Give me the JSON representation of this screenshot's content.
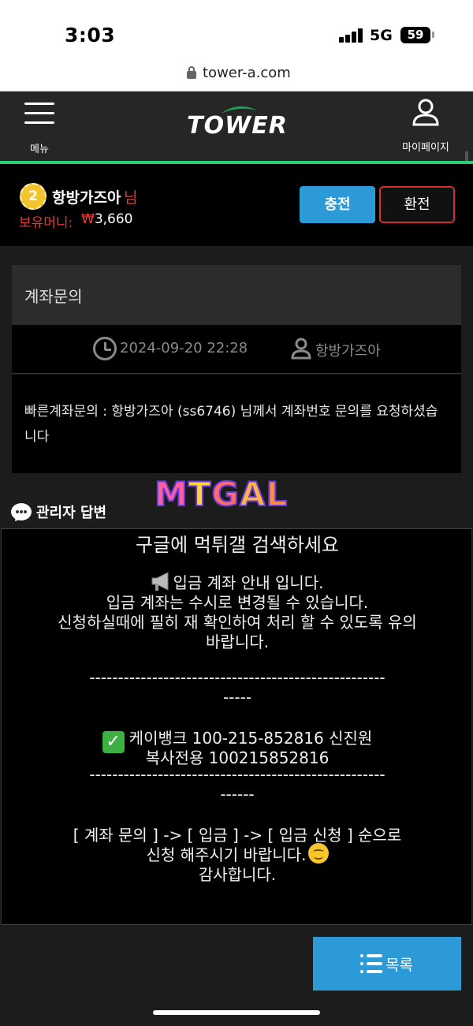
{
  "status_bar": {
    "time": "3:03",
    "network": "5G",
    "battery": "59"
  },
  "browser": {
    "url": "tower-a.com"
  },
  "header": {
    "menu_label": "메뉴",
    "logo_text": "TOWER",
    "mypage_label": "마이페이지"
  },
  "user": {
    "level": "2",
    "name": "항방가즈아",
    "suffix": "님",
    "money_label": "보유머니:",
    "money_currency": "₩",
    "money_value": "3,660",
    "charge_label": "충전",
    "exchange_label": "환전"
  },
  "post": {
    "title": "계좌문의",
    "date": "2024-09-20 22:28",
    "author": "항방가즈아",
    "body": "빠른계좌문의 : 항방가즈아 (ss6746) 님께서 계좌번호 문의를 요청하셨습니다"
  },
  "watermark": "MTGAL",
  "reply": {
    "label": "관리자 답변",
    "lines": [
      "구글에 먹튀갤 검색하세요",
      "입금 계좌 안내 입니다.",
      "입금 계좌는 수시로 변경될 수 있습니다.",
      "신청하실때에 필히 재 확인하여 처리 할 수 있도록 유의",
      "바랍니다.",
      "----------------------------------------------------",
      "-----",
      "케이뱅크 100-215-852816 신진원",
      "복사전용 100215852816",
      "----------------------------------------------------",
      "------",
      "[ 계좌 문의 ] -> [ 입금 ] -> [ 입금 신청 ] 순으로",
      "신청 해주시기 바랍니다.",
      "감사합니다."
    ]
  },
  "list_button": {
    "label": "목록"
  },
  "colors": {
    "accent_blue": "#2d9ad8",
    "accent_green": "#2ecc71",
    "alert_red": "#e53935"
  }
}
